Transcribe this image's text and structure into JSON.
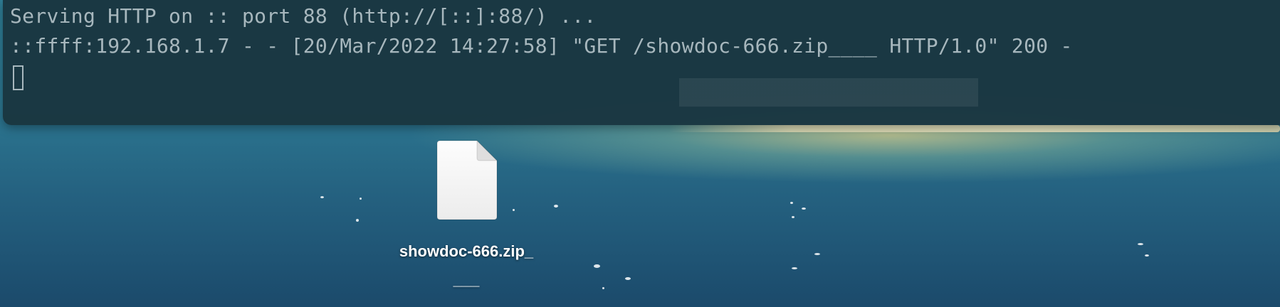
{
  "terminal": {
    "line1": "Serving HTTP on :: port 88 (http://[::]:88/) ...",
    "line2": "::ffff:192.168.1.7 - - [20/Mar/2022 14:27:58] \"GET /showdoc-666.zip____ HTTP/1.0\" 200 -"
  },
  "desktop": {
    "file": {
      "icon": "document-icon",
      "name_line1": "showdoc-666.zip_",
      "name_line2": "___"
    }
  },
  "colors": {
    "terminal_bg": "#1a3640",
    "terminal_text": "#a7b7bd",
    "desktop_top": "#2e7d95",
    "desktop_bottom": "#1b4a6b",
    "file_label": "#ffffff"
  }
}
